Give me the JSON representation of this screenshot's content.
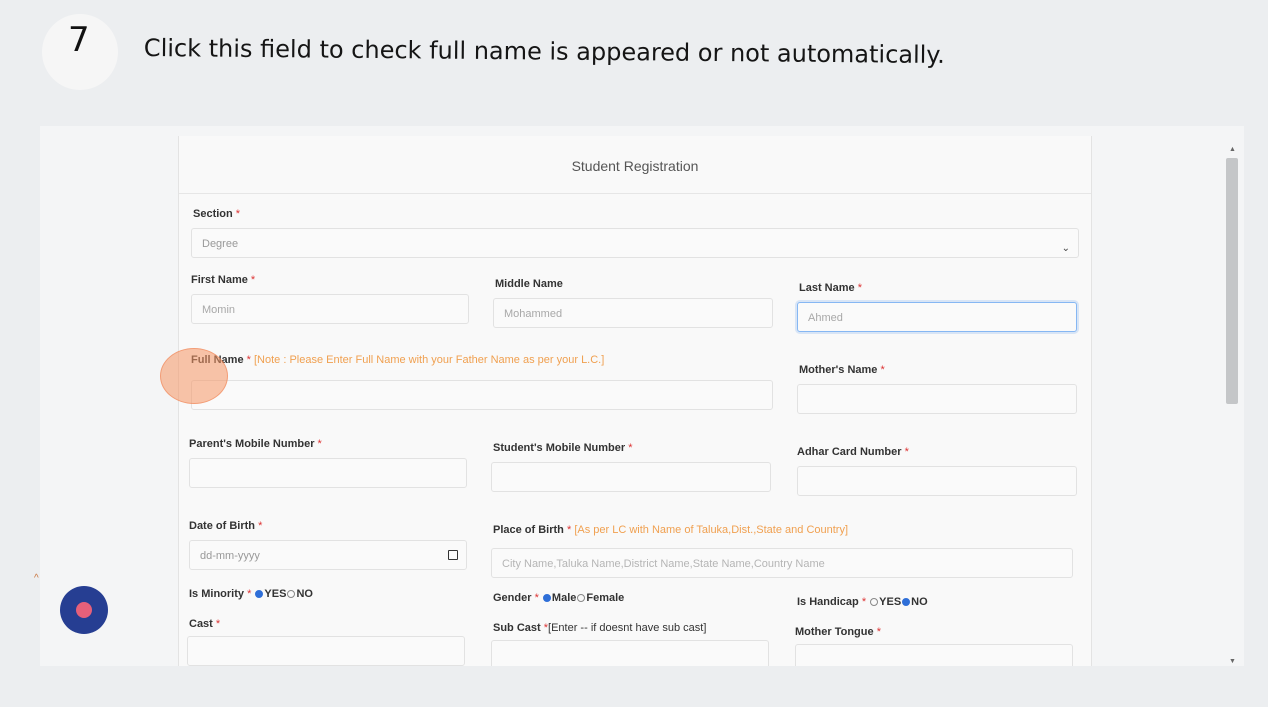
{
  "step": {
    "number": "7",
    "instruction": "Click this field to check full name is appeared or not automatically."
  },
  "form": {
    "title": "Student Registration",
    "section": {
      "label": "Section",
      "value": "Degree"
    },
    "first_name": {
      "label": "First Name",
      "value": "Momin"
    },
    "middle_name": {
      "label": "Middle Name",
      "value": "Mohammed"
    },
    "last_name": {
      "label": "Last Name",
      "value": "Ahmed"
    },
    "full_name": {
      "label": "Full Name",
      "note": "[Note : Please Enter Full Name with your Father Name as per your L.C.]",
      "value": ""
    },
    "mothers_name": {
      "label": "Mother's Name",
      "value": ""
    },
    "parent_mobile": {
      "label": "Parent's Mobile Number",
      "value": ""
    },
    "student_mobile": {
      "label": "Student's Mobile Number",
      "value": ""
    },
    "adhar": {
      "label": "Adhar Card Number",
      "value": ""
    },
    "dob": {
      "label": "Date of Birth",
      "placeholder": "dd-mm-yyyy"
    },
    "place_of_birth": {
      "label": "Place of Birth",
      "note": "[As per LC with Name of Taluka,Dist.,State and Country]",
      "placeholder": "City Name,Taluka Name,District Name,State Name,Country Name"
    },
    "is_minority": {
      "label": "Is Minority",
      "yes": "YES",
      "no": "NO",
      "selected": "YES"
    },
    "gender": {
      "label": "Gender",
      "male": "Male",
      "female": "Female",
      "selected": "Male"
    },
    "is_handicap": {
      "label": "Is Handicap",
      "yes": "YES",
      "no": "NO",
      "selected": "NO"
    },
    "cast": {
      "label": "Cast",
      "value": ""
    },
    "sub_cast": {
      "label": "Sub Cast",
      "note": "[Enter -- if doesnt have sub cast]",
      "value": ""
    },
    "mother_tongue": {
      "label": "Mother Tongue",
      "value": ""
    },
    "required_mark": "*"
  },
  "colors": {
    "accent": "#2f6fd8",
    "note": "#f0a050",
    "help_button": "#263e92",
    "click_marker": "#f59664"
  }
}
